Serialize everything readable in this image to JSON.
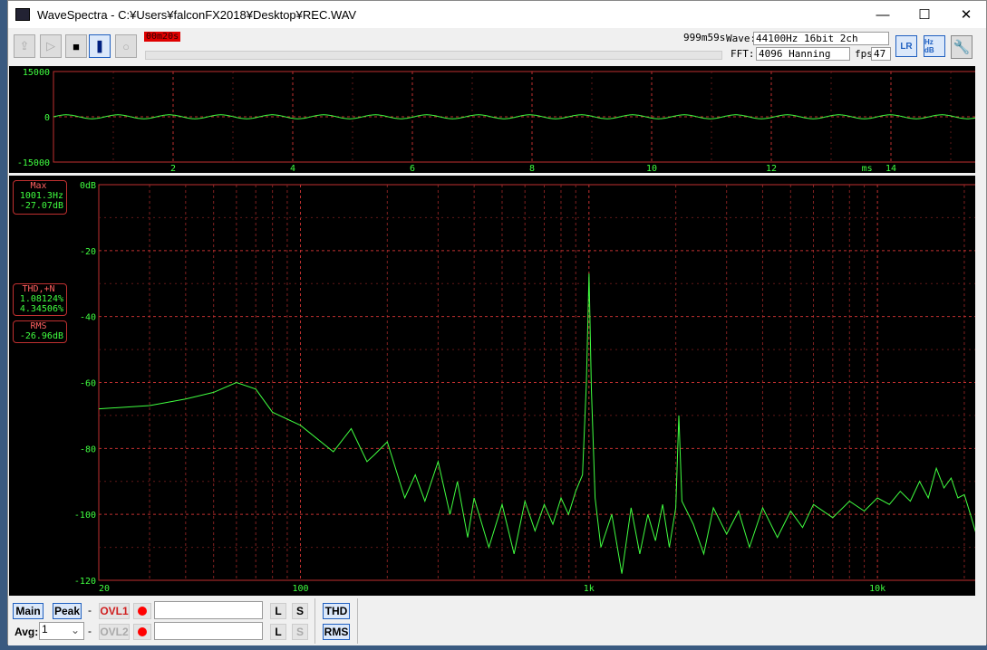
{
  "window": {
    "title": "WaveSpectra - C:¥Users¥falconFX2018¥Desktop¥REC.WAV",
    "minimize": "—",
    "maximize": "☐",
    "close": "✕"
  },
  "toolbar": {
    "rec_time": "00m20s",
    "total_time": "999m59s",
    "wave_label": "Wave:",
    "wave_value": "44100Hz 16bit 2ch",
    "fft_label": "FFT:",
    "fft_value": "4096 Hanning",
    "fps_label": "fps:",
    "fps_value": "47",
    "lr_label": "LR",
    "hzdb_label": "Hz dB"
  },
  "readouts": {
    "max_label": "Max",
    "max_freq": "1001.3Hz",
    "max_db": "-27.07dB",
    "thd_label": "THD,+N",
    "thd": "1.08124%",
    "thdn": "4.34506%",
    "rms_label": "RMS",
    "rms": "-26.96dB"
  },
  "bottom": {
    "main": "Main",
    "peak": "Peak",
    "dash": "-",
    "ovl1": "OVL1",
    "ovl2": "OVL2",
    "avg_label": "Avg:",
    "avg_value": "1",
    "l": "L",
    "s": "S",
    "thd": "THD",
    "rms": "RMS"
  },
  "chart_data": [
    {
      "type": "line",
      "title": "waveform",
      "xlabel": "ms",
      "xlim": [
        0,
        15.5
      ],
      "ylim": [
        -15000,
        15000
      ],
      "yticks": [
        "15000",
        "0",
        "-15000"
      ],
      "xticks": [
        "2",
        "4",
        "6",
        "8",
        "10",
        "12",
        "14"
      ],
      "signal": {
        "frequency_hz": 1001.3,
        "amplitude": 650
      },
      "color": "#40ff40"
    },
    {
      "type": "line",
      "title": "spectrum",
      "xscale": "log",
      "xlim": [
        20,
        22300
      ],
      "ylim": [
        -120,
        0
      ],
      "yticks": [
        "0dB",
        "-20",
        "-40",
        "-60",
        "-80",
        "-100",
        "-120"
      ],
      "xticks": [
        "20",
        "100",
        "1k",
        "10k"
      ],
      "x": [
        20,
        30,
        40,
        50,
        60,
        70,
        80,
        100,
        130,
        150,
        170,
        180,
        200,
        230,
        250,
        270,
        300,
        330,
        350,
        380,
        400,
        450,
        500,
        550,
        600,
        650,
        700,
        750,
        800,
        850,
        900,
        950,
        980,
        1001,
        1020,
        1050,
        1100,
        1200,
        1300,
        1400,
        1500,
        1600,
        1700,
        1800,
        1900,
        2000,
        2050,
        2100,
        2300,
        2500,
        2700,
        3000,
        3300,
        3600,
        4000,
        4500,
        5000,
        5500,
        6000,
        7000,
        8000,
        9000,
        10000,
        11000,
        12000,
        13000,
        14000,
        15000,
        16000,
        17000,
        18000,
        19000,
        20000,
        21000,
        22000
      ],
      "y": [
        -68,
        -67,
        -65,
        -63,
        -60,
        -62,
        -69,
        -73,
        -81,
        -74,
        -84,
        -82,
        -78,
        -95,
        -88,
        -96,
        -84,
        -100,
        -90,
        -107,
        -95,
        -110,
        -97,
        -112,
        -96,
        -105,
        -97,
        -103,
        -95,
        -100,
        -93,
        -88,
        -60,
        -27,
        -62,
        -95,
        -110,
        -100,
        -118,
        -98,
        -112,
        -100,
        -108,
        -97,
        -110,
        -98,
        -70,
        -96,
        -103,
        -112,
        -98,
        -106,
        -99,
        -110,
        -98,
        -107,
        -99,
        -104,
        -97,
        -101,
        -96,
        -99,
        -95,
        -97,
        -93,
        -96,
        -90,
        -95,
        -86,
        -92,
        -89,
        -95,
        -94,
        -100,
        -106
      ],
      "color": "#40ff40"
    }
  ]
}
